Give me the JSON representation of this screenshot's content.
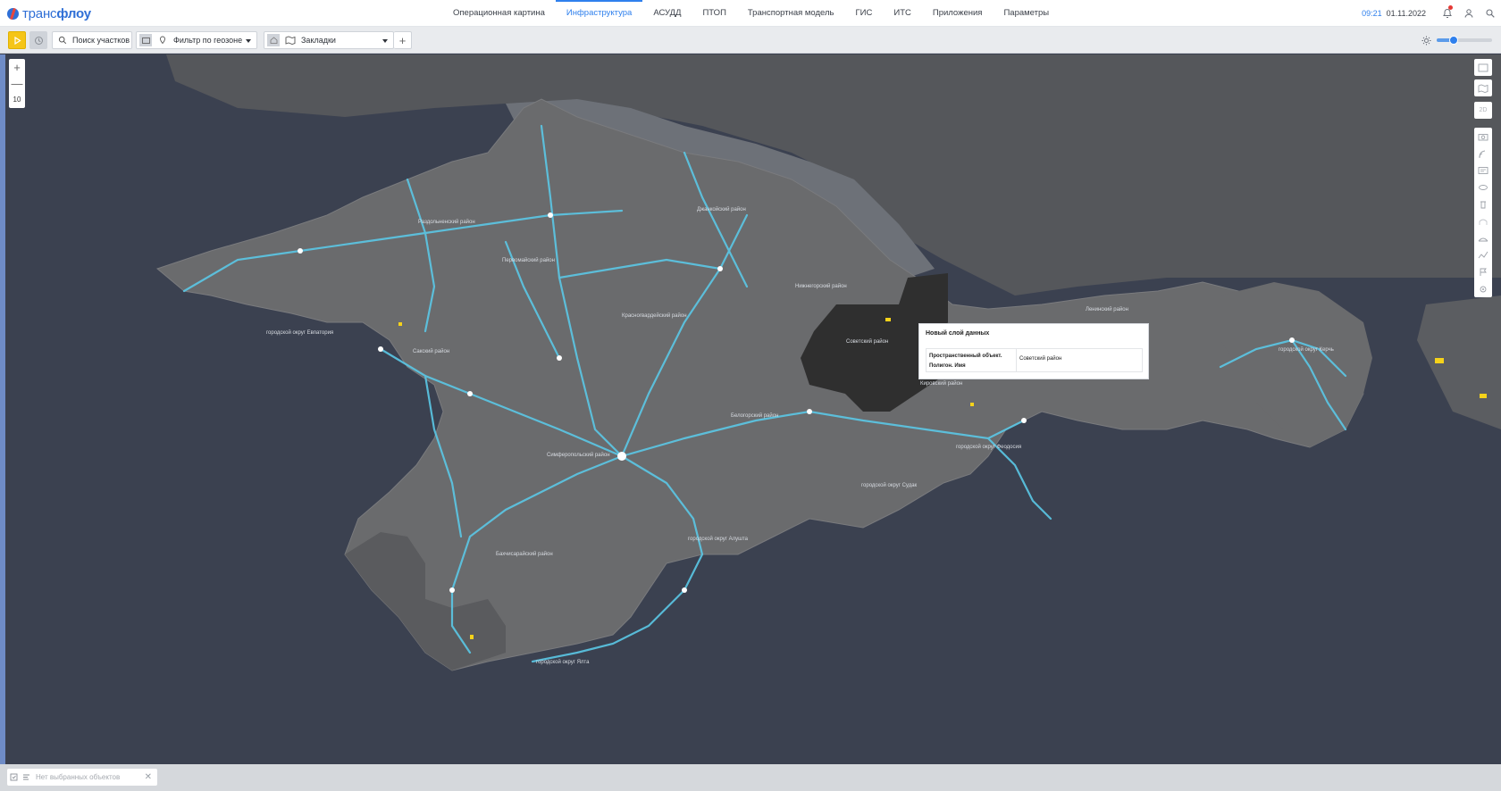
{
  "app": {
    "logo_prefix": "транс",
    "logo_suffix": "флоу"
  },
  "nav": [
    {
      "label": "Операционная картина",
      "active": false
    },
    {
      "label": "Инфраструктура",
      "active": true
    },
    {
      "label": "АСУДД",
      "active": false
    },
    {
      "label": "ПТОП",
      "active": false
    },
    {
      "label": "Транспортная модель",
      "active": false
    },
    {
      "label": "ГИС",
      "active": false
    },
    {
      "label": "ИТС",
      "active": false
    },
    {
      "label": "Приложения",
      "active": false
    },
    {
      "label": "Параметры",
      "active": false
    }
  ],
  "header": {
    "time": "09:21",
    "date": "01.11.2022",
    "has_notification": true,
    "icons": [
      "bell-icon",
      "user-icon",
      "search-icon"
    ]
  },
  "toolbar": {
    "search_label": "Поиск участков",
    "filter_label": "Фильтр по геозоне",
    "bookmarks_label": "Закладки",
    "add_symbol": "+",
    "brightness": 0.3
  },
  "map": {
    "zoom_level": "10",
    "zoom_in": "+",
    "zoom_out": "—",
    "mode_3d_label": "2D",
    "accent_color": "#5bc8e6",
    "highlight_color": "#2f2f2f",
    "land_color": "#6a6b6d",
    "sea_color": "#3b4150",
    "places": [
      "Раздольненский район",
      "Первомайский район",
      "Джанкойский район",
      "Нижнегорский район",
      "Красногвардейский район",
      "Ленинский район",
      "Советский район",
      "Кировский район",
      "Белогорский район",
      "городской округ Евпатория",
      "Сакский район",
      "Симферопольский район",
      "Бахчисарайский район",
      "городской округ Алушта",
      "городской округ Судак",
      "городской округ Феодосия",
      "городской округ Ялта",
      "городской округ Керчь"
    ]
  },
  "popup": {
    "title": "Новый слой данных",
    "key": "Пространственный объект. Полигон. Имя",
    "value": "Советский район"
  },
  "bottom": {
    "selection_text": "Нет выбранных объектов",
    "close": "✕"
  }
}
